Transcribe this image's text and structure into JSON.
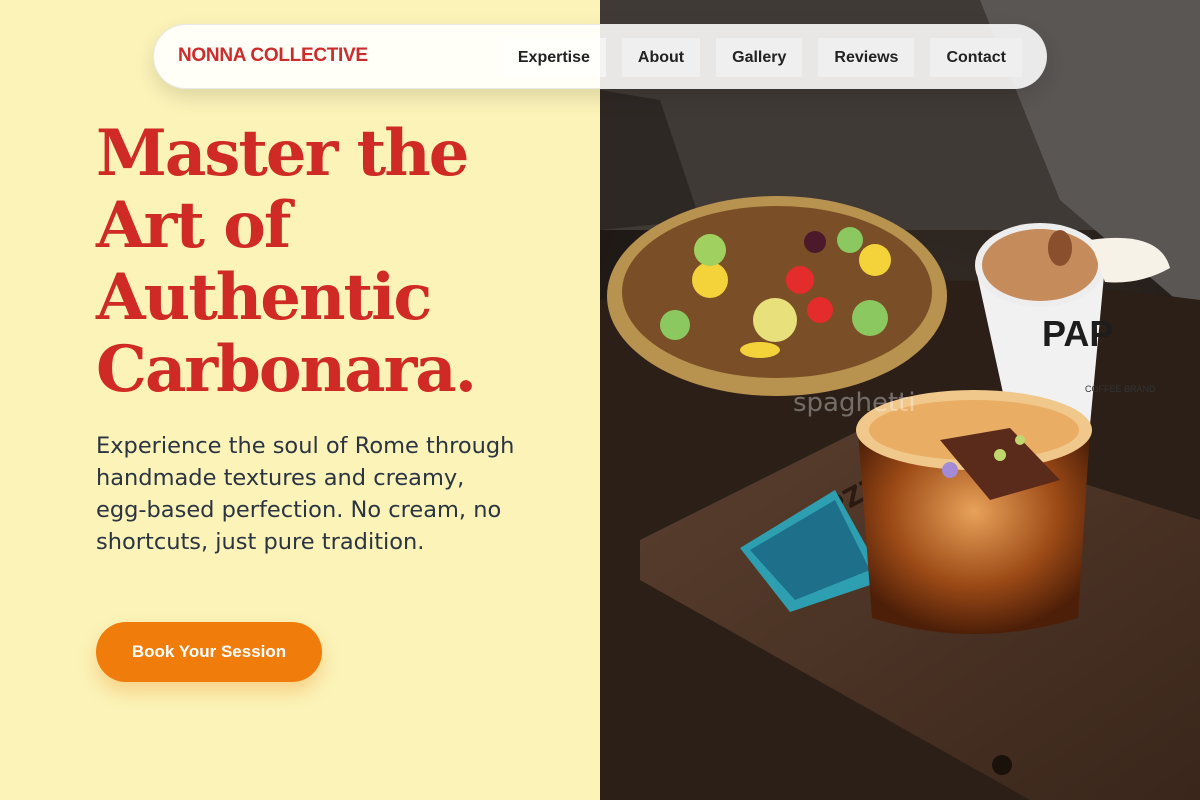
{
  "brand": {
    "name": "NONNA COLLECTIVE",
    "color": "#cc2c2c"
  },
  "nav": {
    "links": [
      "Expertise",
      "About",
      "Gallery",
      "Reviews",
      "Contact"
    ]
  },
  "hero": {
    "headline": "Master the Art of Authentic Carbonara.",
    "subtext": "Experience the soul of Rome through handmade textures and creamy, egg-based perfection. No cream, no shortcuts, just pure tradition.",
    "cta": "Book Your Session"
  },
  "photo": {
    "cup_text": "PAP",
    "cup_subtext": "COFFEE BRAND",
    "tray_text": "PAPZZ",
    "watermark": "spaghetti"
  },
  "colors": {
    "background": "#fbf3b8",
    "headline": "#cf2a26",
    "cta": "#f07c0c",
    "body_text": "#2b3442"
  }
}
